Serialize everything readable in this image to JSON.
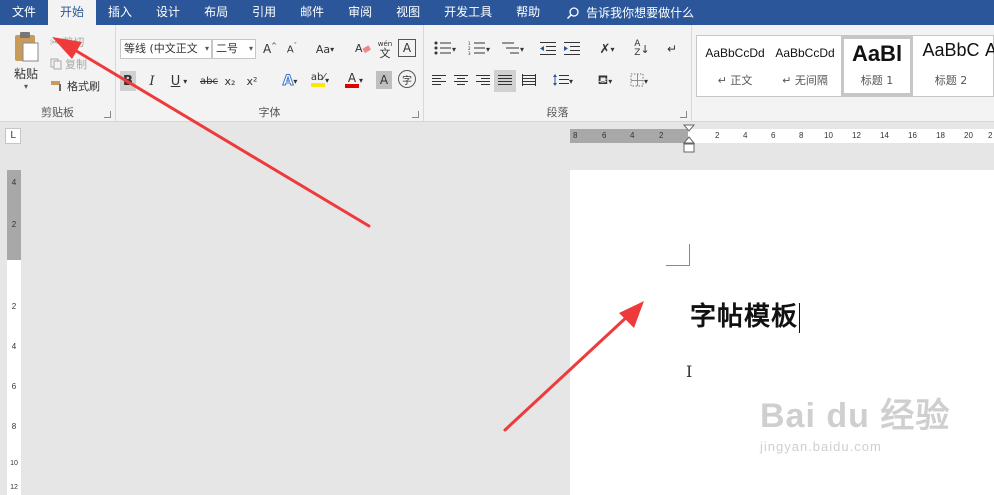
{
  "menubar": {
    "tabs": [
      "文件",
      "开始",
      "插入",
      "设计",
      "布局",
      "引用",
      "邮件",
      "审阅",
      "视图",
      "开发工具",
      "帮助"
    ],
    "active": "开始",
    "tell_me": "告诉我你想要做什么"
  },
  "clipboard": {
    "paste": "粘贴",
    "cut": "剪切",
    "copy": "复制",
    "format_painter": "格式刷",
    "label": "剪贴板"
  },
  "font": {
    "name": "等线 (中文正文",
    "size": "二号",
    "change_case": "Aa",
    "phonetic_top": "wén",
    "phonetic_bottom": "文",
    "enclosed_char": "A",
    "bold": "B",
    "italic": "I",
    "underline": "U",
    "strike": "abc",
    "subscript": "x₂",
    "superscript": "x²",
    "font_color": "A",
    "char_shading": "A",
    "enclose": "字",
    "label": "字体"
  },
  "paragraph": {
    "label": "段落"
  },
  "styles": {
    "items": [
      {
        "sample": "AaBbCcDd",
        "name": "↵ 正文"
      },
      {
        "sample": "AaBbCcDd",
        "name": "↵ 无间隔"
      },
      {
        "sample": "AaBl",
        "name": "标题 1"
      },
      {
        "sample": "AaBbC",
        "name": "标题 2"
      },
      {
        "sample": "A",
        "name": ""
      }
    ]
  },
  "ruler": {
    "corner": "L",
    "h_labels": [
      "8",
      "6",
      "4",
      "2",
      "2",
      "4",
      "6",
      "8",
      "10",
      "12",
      "14",
      "16",
      "18",
      "20",
      "2"
    ],
    "v_labels": [
      "4",
      "2",
      "2",
      "4",
      "6",
      "8",
      "10",
      "12"
    ]
  },
  "document": {
    "text": "字帖模板"
  },
  "watermark": {
    "brand": "Bai du 经验",
    "url": "jingyan.baidu.com"
  },
  "colors": {
    "menubar": "#2b579a",
    "ribbon": "#f3f3f3",
    "arrow": "#ee3a3a",
    "highlight_yellow": "#ffe600",
    "font_red": "#e00000"
  }
}
